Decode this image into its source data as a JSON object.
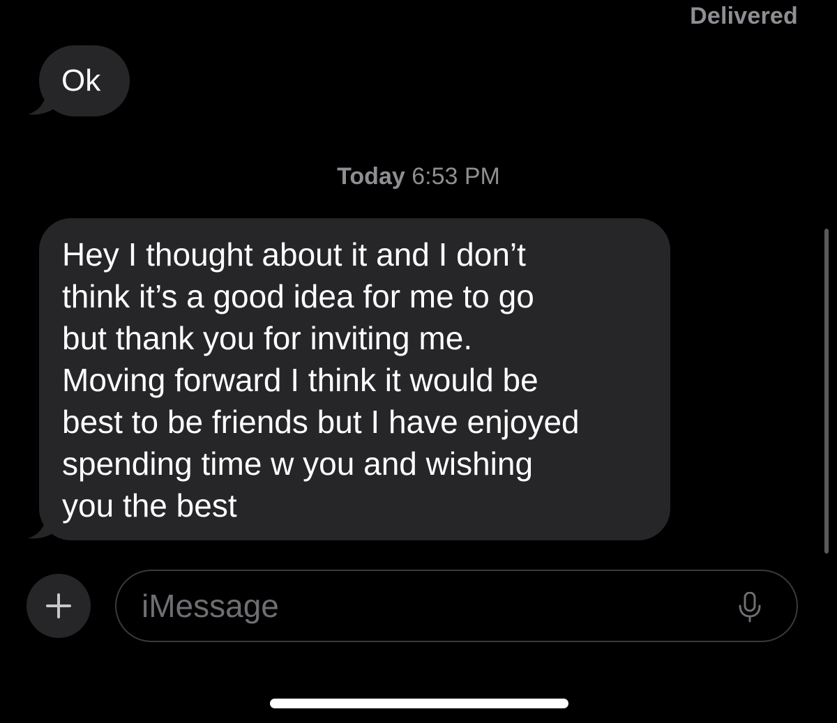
{
  "status": {
    "delivered_label": "Delivered"
  },
  "messages": [
    {
      "direction": "incoming",
      "text": "Ok"
    },
    {
      "direction": "incoming",
      "lines": [
        "Hey I thought about it and I don’t",
        "think it’s a good idea for me to go",
        "but thank you for inviting me.",
        "Moving forward I think it would be",
        "best to be friends but I have enjoyed",
        "spending time w you and wishing",
        "you the best"
      ]
    }
  ],
  "timestamp": {
    "day": "Today",
    "time": "6:53 PM"
  },
  "composer": {
    "placeholder": "iMessage",
    "add_icon": "plus-icon",
    "mic_icon": "microphone-icon"
  },
  "colors": {
    "background": "#000000",
    "incoming_bubble": "#262628",
    "secondary_text": "#8e8e93"
  }
}
